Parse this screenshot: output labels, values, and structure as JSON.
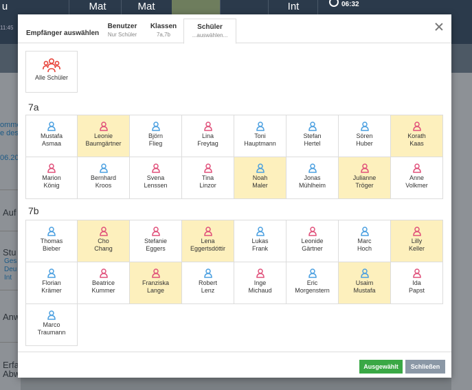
{
  "background": {
    "top_cells": [
      {
        "label": "u"
      },
      {
        "label": "Mat"
      },
      {
        "label": "Mat"
      },
      {
        "label": "Int"
      }
    ],
    "clock_time": "06:32",
    "side_texts": {
      "time1": "11:45",
      "link1": "omme",
      "link2": "e des",
      "date": "06.20",
      "auf": "Auf",
      "stu": "Stu",
      "ges": "Ges",
      "deu": "Deu",
      "int": "Int",
      "anw": "Anw",
      "erfa": "Erfa",
      "abw": "Abw"
    }
  },
  "modal": {
    "title": "Empfänger auswählen",
    "tabs": [
      {
        "title": "Benutzer",
        "sub": "Nur Schüler"
      },
      {
        "title": "Klassen",
        "sub": "7a,7b"
      },
      {
        "title": "Schüler",
        "sub": "...auswählen..."
      }
    ],
    "all_students_label": "Alle Schüler",
    "groups": [
      {
        "title": "7a",
        "students": [
          {
            "first": "Mustafa",
            "last": "Asmaa",
            "gender": "m",
            "selected": false
          },
          {
            "first": "Leonie",
            "last": "Baumgärtner",
            "gender": "f",
            "selected": true
          },
          {
            "first": "Björn",
            "last": "Flieg",
            "gender": "m",
            "selected": false
          },
          {
            "first": "Lina",
            "last": "Freytag",
            "gender": "f",
            "selected": false
          },
          {
            "first": "Toni",
            "last": "Hauptmann",
            "gender": "m",
            "selected": false
          },
          {
            "first": "Stefan",
            "last": "Hertel",
            "gender": "m",
            "selected": false
          },
          {
            "first": "Sören",
            "last": "Huber",
            "gender": "m",
            "selected": false
          },
          {
            "first": "Korath",
            "last": "Kaas",
            "gender": "f",
            "selected": true
          },
          {
            "first": "Marion",
            "last": "König",
            "gender": "f",
            "selected": false
          },
          {
            "first": "Bernhard",
            "last": "Kroos",
            "gender": "m",
            "selected": false
          },
          {
            "first": "Svena",
            "last": "Lenssen",
            "gender": "f",
            "selected": false
          },
          {
            "first": "Tina",
            "last": "Linzor",
            "gender": "f",
            "selected": false
          },
          {
            "first": "Noah",
            "last": "Maler",
            "gender": "m",
            "selected": true
          },
          {
            "first": "Jonas",
            "last": "Mühlheim",
            "gender": "m",
            "selected": false
          },
          {
            "first": "Julianne",
            "last": "Tröger",
            "gender": "f",
            "selected": true
          },
          {
            "first": "Anne",
            "last": "Volkmer",
            "gender": "f",
            "selected": false
          }
        ]
      },
      {
        "title": "7b",
        "students": [
          {
            "first": "Thomas",
            "last": "Bieber",
            "gender": "m",
            "selected": false
          },
          {
            "first": "Cho",
            "last": "Chang",
            "gender": "f",
            "selected": true
          },
          {
            "first": "Stefanie",
            "last": "Eggers",
            "gender": "f",
            "selected": false
          },
          {
            "first": "Lena",
            "last": "Eggertsdóttir",
            "gender": "f",
            "selected": true
          },
          {
            "first": "Lukas",
            "last": "Frank",
            "gender": "m",
            "selected": false
          },
          {
            "first": "Leonide",
            "last": "Gärtner",
            "gender": "f",
            "selected": false
          },
          {
            "first": "Marc",
            "last": "Hoch",
            "gender": "m",
            "selected": false
          },
          {
            "first": "Lilly",
            "last": "Keller",
            "gender": "f",
            "selected": true
          },
          {
            "first": "Florian",
            "last": "Krämer",
            "gender": "m",
            "selected": false
          },
          {
            "first": "Beatrice",
            "last": "Kummer",
            "gender": "f",
            "selected": false
          },
          {
            "first": "Franziska",
            "last": "Lange",
            "gender": "f",
            "selected": true
          },
          {
            "first": "Robert",
            "last": "Lenz",
            "gender": "m",
            "selected": false
          },
          {
            "first": "Inge",
            "last": "Michaud",
            "gender": "f",
            "selected": false
          },
          {
            "first": "Eric",
            "last": "Morgenstern",
            "gender": "m",
            "selected": false
          },
          {
            "first": "Usaim",
            "last": "Mustafa",
            "gender": "m",
            "selected": true
          },
          {
            "first": "Ida",
            "last": "Papst",
            "gender": "f",
            "selected": false
          },
          {
            "first": "Marco",
            "last": "Traumann",
            "gender": "m",
            "selected": false
          }
        ]
      }
    ],
    "buttons": {
      "ok": "Ausgewählt",
      "close": "Schließen"
    },
    "colors": {
      "male_icon": "#4a9fe0",
      "female_icon": "#e0507a",
      "selected_bg": "#fdf0bd",
      "ok_button": "#3aa845",
      "close_button": "#8b98a6",
      "group_icon": "#e8453c"
    },
    "icons": {
      "student": "person-outline-icon",
      "all": "group-icon",
      "close": "close-icon"
    }
  }
}
